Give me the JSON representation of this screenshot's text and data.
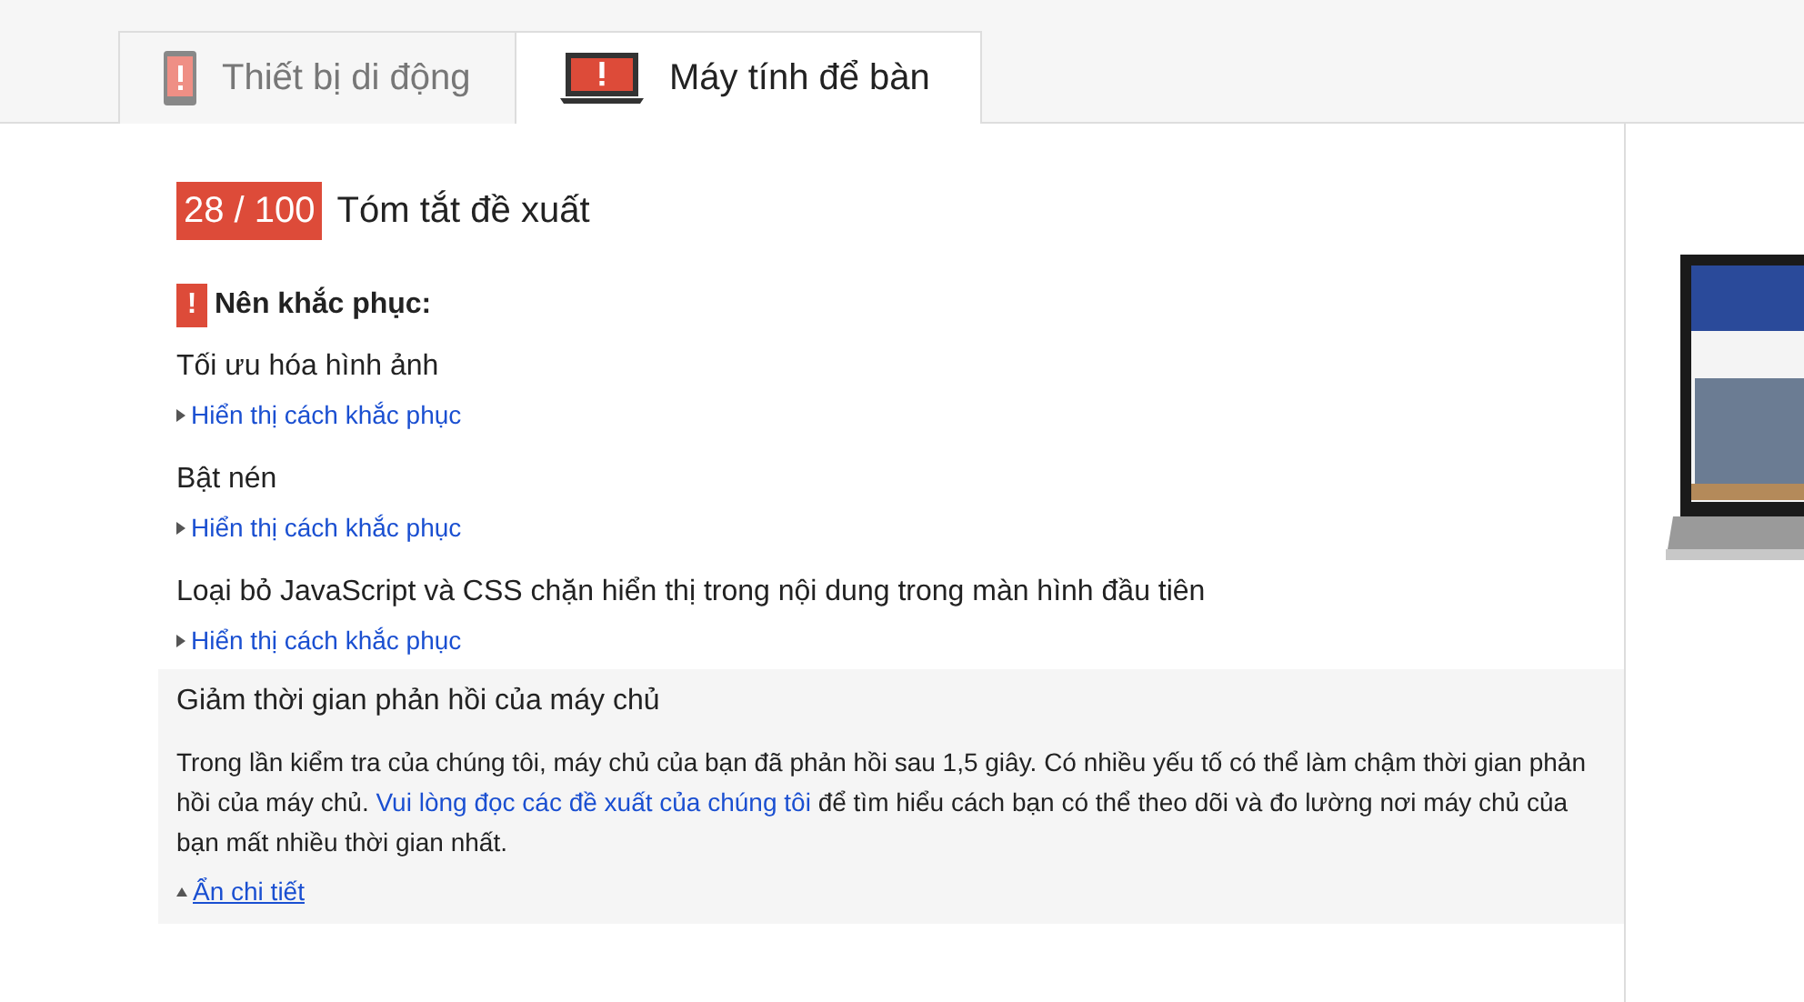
{
  "tabs": [
    {
      "kind": "mobile",
      "label": "Thiết bị di động",
      "selected": false
    },
    {
      "kind": "desktop",
      "label": "Máy tính để bàn",
      "selected": true
    }
  ],
  "score": {
    "value": "28 / 100",
    "title": "Tóm tắt đề xuất"
  },
  "section": {
    "icon": "!",
    "heading": "Nên khắc phục:"
  },
  "rules": [
    {
      "title": "Tối ưu hóa hình ảnh",
      "expanded": false,
      "toggle": "Hiển thị cách khắc phục"
    },
    {
      "title": "Bật nén",
      "expanded": false,
      "toggle": "Hiển thị cách khắc phục"
    },
    {
      "title": "Loại bỏ JavaScript và CSS chặn hiển thị trong nội dung trong màn hình đầu tiên",
      "expanded": false,
      "toggle": "Hiển thị cách khắc phục"
    },
    {
      "title": "Giảm thời gian phản hồi của máy chủ",
      "expanded": true,
      "toggle": "Ẩn chi tiết",
      "details": {
        "before": "Trong lần kiểm tra của chúng tôi, máy chủ của bạn đã phản hồi sau 1,5 giây. Có nhiều yếu tố có thể làm chậm thời gian phản hồi của máy chủ.",
        "link": "Vui lòng đọc các đề xuất của chúng tôi",
        "after": "để tìm hiểu cách bạn có thể theo dõi và đo lường nơi máy chủ của bạn mất nhiều thời gian nhất."
      }
    }
  ]
}
